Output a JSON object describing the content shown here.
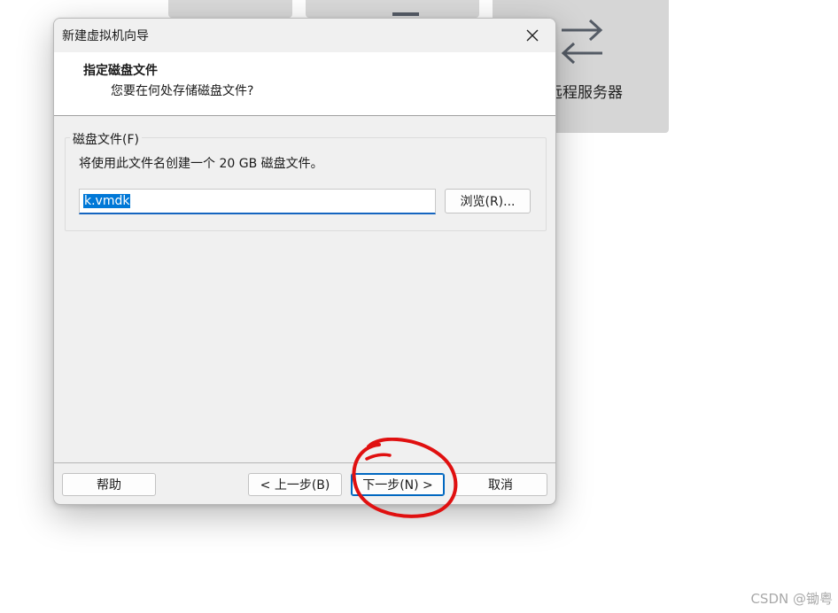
{
  "background": {
    "tile3_label": "远程服务器",
    "tile3_icon": "transfer-arrows-icon"
  },
  "dialog": {
    "title": "新建虚拟机向导",
    "close_icon": "close-icon",
    "header": {
      "title": "指定磁盘文件",
      "subtitle": "您要在何处存储磁盘文件?"
    },
    "group": {
      "legend": "磁盘文件(F)",
      "description": "将使用此文件名创建一个 20 GB 磁盘文件。",
      "filename_value": "k.vmdk",
      "browse_label": "浏览(R)..."
    },
    "footer": {
      "help_label": "帮助",
      "back_label": "< 上一步(B)",
      "next_label": "下一步(N) >",
      "cancel_label": "取消"
    }
  },
  "watermark": "CSDN @锄粤",
  "colors": {
    "accent": "#0067c0",
    "selection": "#0078d7",
    "annotation": "#e01010"
  }
}
